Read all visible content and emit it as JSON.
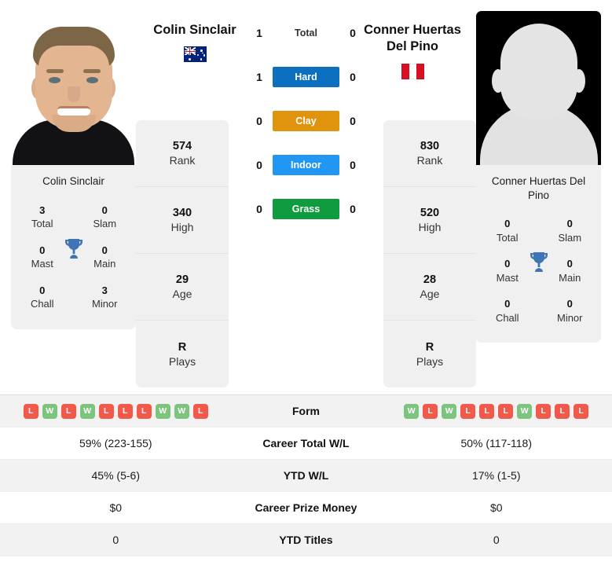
{
  "players": {
    "left": {
      "name": "Colin Sinclair",
      "card_name": "Colin Sinclair",
      "country": "Australia",
      "flag": "au-flag-icon",
      "photo": "player-photo",
      "stats": [
        {
          "value": "574",
          "label": "Rank"
        },
        {
          "value": "340",
          "label": "High"
        },
        {
          "value": "29",
          "label": "Age"
        },
        {
          "value": "R",
          "label": "Plays"
        }
      ],
      "titles": [
        {
          "value": "3",
          "label": "Total"
        },
        {
          "value": "0",
          "label": "Slam"
        },
        {
          "value": "0",
          "label": "Mast"
        },
        {
          "value": "0",
          "label": "Main"
        },
        {
          "value": "0",
          "label": "Chall"
        },
        {
          "value": "3",
          "label": "Minor"
        }
      ],
      "form": [
        "L",
        "W",
        "L",
        "W",
        "L",
        "L",
        "L",
        "W",
        "W",
        "L"
      ],
      "career_total_wl": "59% (223-155)",
      "ytd_wl": "45% (5-6)",
      "career_prize_money": "$0",
      "ytd_titles": "0"
    },
    "right": {
      "name": "Conner Huertas Del Pino",
      "card_name": "Conner Huertas Del Pino",
      "country": "Peru",
      "flag": "pe-flag-icon",
      "photo": "player-photo-placeholder",
      "stats": [
        {
          "value": "830",
          "label": "Rank"
        },
        {
          "value": "520",
          "label": "High"
        },
        {
          "value": "28",
          "label": "Age"
        },
        {
          "value": "R",
          "label": "Plays"
        }
      ],
      "titles": [
        {
          "value": "0",
          "label": "Total"
        },
        {
          "value": "0",
          "label": "Slam"
        },
        {
          "value": "0",
          "label": "Mast"
        },
        {
          "value": "0",
          "label": "Main"
        },
        {
          "value": "0",
          "label": "Chall"
        },
        {
          "value": "0",
          "label": "Minor"
        }
      ],
      "form": [
        "W",
        "L",
        "W",
        "L",
        "L",
        "L",
        "W",
        "L",
        "L",
        "L"
      ],
      "career_total_wl": "50% (117-118)",
      "ytd_wl": "17% (1-5)",
      "career_prize_money": "$0",
      "ytd_titles": "0"
    }
  },
  "head_to_head": {
    "rows": [
      {
        "label": "Total",
        "left": "1",
        "right": "0",
        "kind": "total",
        "color": ""
      },
      {
        "label": "Hard",
        "left": "1",
        "right": "0",
        "kind": "surface",
        "color": "#0d6fc0"
      },
      {
        "label": "Clay",
        "left": "0",
        "right": "0",
        "kind": "surface",
        "color": "#e0930c"
      },
      {
        "label": "Indoor",
        "left": "0",
        "right": "0",
        "kind": "surface",
        "color": "#2196f3"
      },
      {
        "label": "Grass",
        "left": "0",
        "right": "0",
        "kind": "surface",
        "color": "#109b3f"
      }
    ]
  },
  "stats_table": {
    "rows": [
      {
        "label": "Form",
        "kind": "form",
        "shaded": true
      },
      {
        "label": "Career Total W/L",
        "kind": "text",
        "shaded": false,
        "key": "career_total_wl"
      },
      {
        "label": "YTD W/L",
        "kind": "text",
        "shaded": true,
        "key": "ytd_wl"
      },
      {
        "label": "Career Prize Money",
        "kind": "text",
        "shaded": false,
        "key": "career_prize_money"
      },
      {
        "label": "YTD Titles",
        "kind": "text",
        "shaded": true,
        "key": "ytd_titles"
      }
    ]
  },
  "colors": {
    "win": "#7dc47f",
    "loss": "#f15a4a",
    "hard": "#0d6fc0",
    "clay": "#e0930c",
    "indoor": "#2196f3",
    "grass": "#109b3f",
    "panel": "#f0f0f0"
  }
}
